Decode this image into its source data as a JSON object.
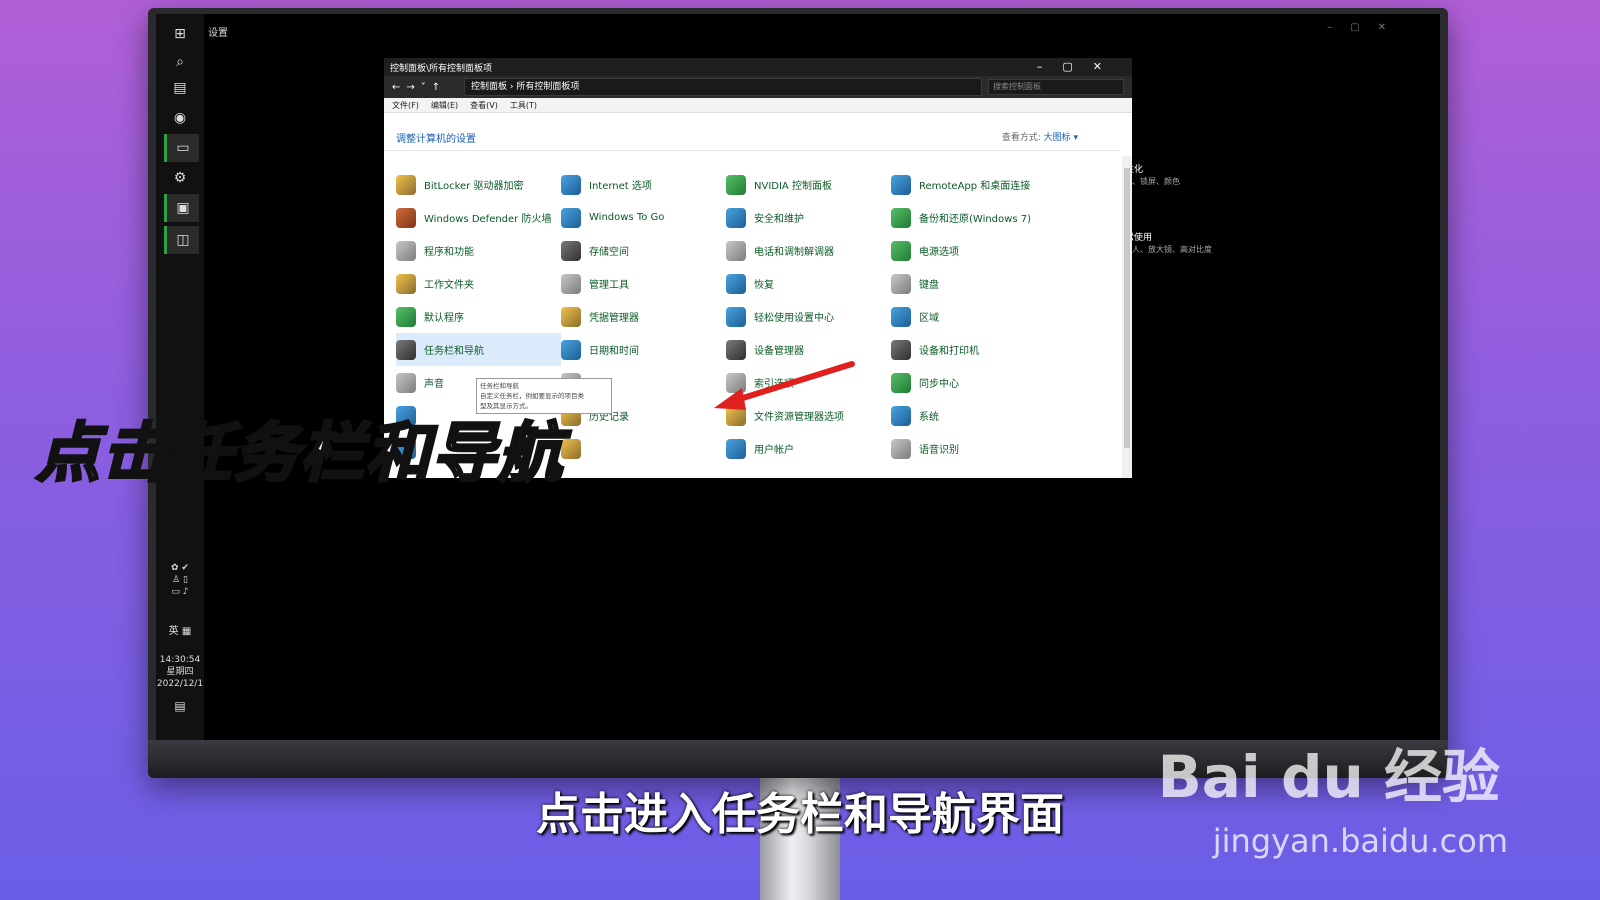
{
  "settings": {
    "title": "设置",
    "side": [
      {
        "title": "个性化",
        "sub": "背景、锁屏、颜色"
      },
      {
        "title": "轻松使用",
        "sub": "讲述人、放大镜、高对比度"
      }
    ]
  },
  "taskbar": {
    "time": "14:30:54",
    "weekday": "星期四",
    "date": "2022/12/1",
    "lang": "英"
  },
  "control_panel": {
    "title": "控制面板\\所有控制面板项",
    "breadcrumb": "控制面板  ›  所有控制面板项",
    "search_placeholder": "搜索控制面板",
    "menu": [
      "文件(F)",
      "编辑(E)",
      "查看(V)",
      "工具(T)"
    ],
    "heading": "调整计算机的设置",
    "view_label": "查看方式:",
    "view_value": "大图标 ▾",
    "items": [
      {
        "label": "BitLocker 驱动器加密",
        "icon": "bitlocker-icon",
        "style": "s1"
      },
      {
        "label": "Internet 选项",
        "icon": "internet-options-icon",
        "style": "s2"
      },
      {
        "label": "NVIDIA 控制面板",
        "icon": "nvidia-icon",
        "style": "s4"
      },
      {
        "label": "RemoteApp 和桌面连接",
        "icon": "remoteapp-icon",
        "style": "s2"
      },
      {
        "label": "Windows Defender 防火墙",
        "icon": "firewall-icon",
        "style": "s6"
      },
      {
        "label": "Windows To Go",
        "icon": "windows-to-go-icon",
        "style": "s2"
      },
      {
        "label": "安全和维护",
        "icon": "flag-icon",
        "style": "s2"
      },
      {
        "label": "备份和还原(Windows 7)",
        "icon": "backup-icon",
        "style": "s4"
      },
      {
        "label": "程序和功能",
        "icon": "programs-icon",
        "style": "s5"
      },
      {
        "label": "存储空间",
        "icon": "storage-icon",
        "style": "s3"
      },
      {
        "label": "电话和调制解调器",
        "icon": "phone-icon",
        "style": "s5"
      },
      {
        "label": "电源选项",
        "icon": "power-icon",
        "style": "s4"
      },
      {
        "label": "工作文件夹",
        "icon": "work-folders-icon",
        "style": "s1"
      },
      {
        "label": "管理工具",
        "icon": "admin-tools-icon",
        "style": "s5"
      },
      {
        "label": "恢复",
        "icon": "recovery-icon",
        "style": "s2"
      },
      {
        "label": "键盘",
        "icon": "keyboard-icon",
        "style": "s5"
      },
      {
        "label": "默认程序",
        "icon": "default-programs-icon",
        "style": "s4"
      },
      {
        "label": "凭据管理器",
        "icon": "credential-icon",
        "style": "s1"
      },
      {
        "label": "轻松使用设置中心",
        "icon": "ease-of-access-icon",
        "style": "s2"
      },
      {
        "label": "区域",
        "icon": "region-icon",
        "style": "s2"
      },
      {
        "label": "任务栏和导航",
        "icon": "taskbar-icon",
        "style": "s3",
        "highlight": true
      },
      {
        "label": "日期和时间",
        "icon": "date-time-icon",
        "style": "s2"
      },
      {
        "label": "设备管理器",
        "icon": "device-manager-icon",
        "style": "s3"
      },
      {
        "label": "设备和打印机",
        "icon": "printer-icon",
        "style": "s3"
      },
      {
        "label": "声音",
        "icon": "sound-icon",
        "style": "s5"
      },
      {
        "label": "",
        "icon": "blank-icon",
        "style": "s5"
      },
      {
        "label": "索引选项",
        "icon": "indexing-icon",
        "style": "s5"
      },
      {
        "label": "同步中心",
        "icon": "sync-icon",
        "style": "s4"
      },
      {
        "label": "",
        "icon": "blank-icon",
        "style": "s2"
      },
      {
        "label": "历史记录",
        "icon": "history-icon",
        "style": "s1"
      },
      {
        "label": "文件资源管理器选项",
        "icon": "folder-options-icon",
        "style": "s1"
      },
      {
        "label": "系统",
        "icon": "system-icon",
        "style": "s2"
      },
      {
        "label": "",
        "icon": "blank-icon",
        "style": "s2"
      },
      {
        "label": "",
        "icon": "blank-icon",
        "style": "s1"
      },
      {
        "label": "用户帐户",
        "icon": "user-accounts-icon",
        "style": "s2"
      },
      {
        "label": "语音识别",
        "icon": "microphone-icon",
        "style": "s5"
      }
    ],
    "tooltip": [
      "任务栏和导航",
      "自定义任务栏，例如要显示的项目类",
      "型及其显示方式。"
    ]
  },
  "overlay": {
    "main_caption": "点击任务栏和导航",
    "subtitle": "点击进入任务栏和导航界面",
    "watermark": "Bai du 经验",
    "watermark_url": "jingyan.baidu.com"
  },
  "colors": {
    "accent": "#1a5fb4",
    "item_text": "#0b5b26",
    "arrow": "#e0201e"
  }
}
